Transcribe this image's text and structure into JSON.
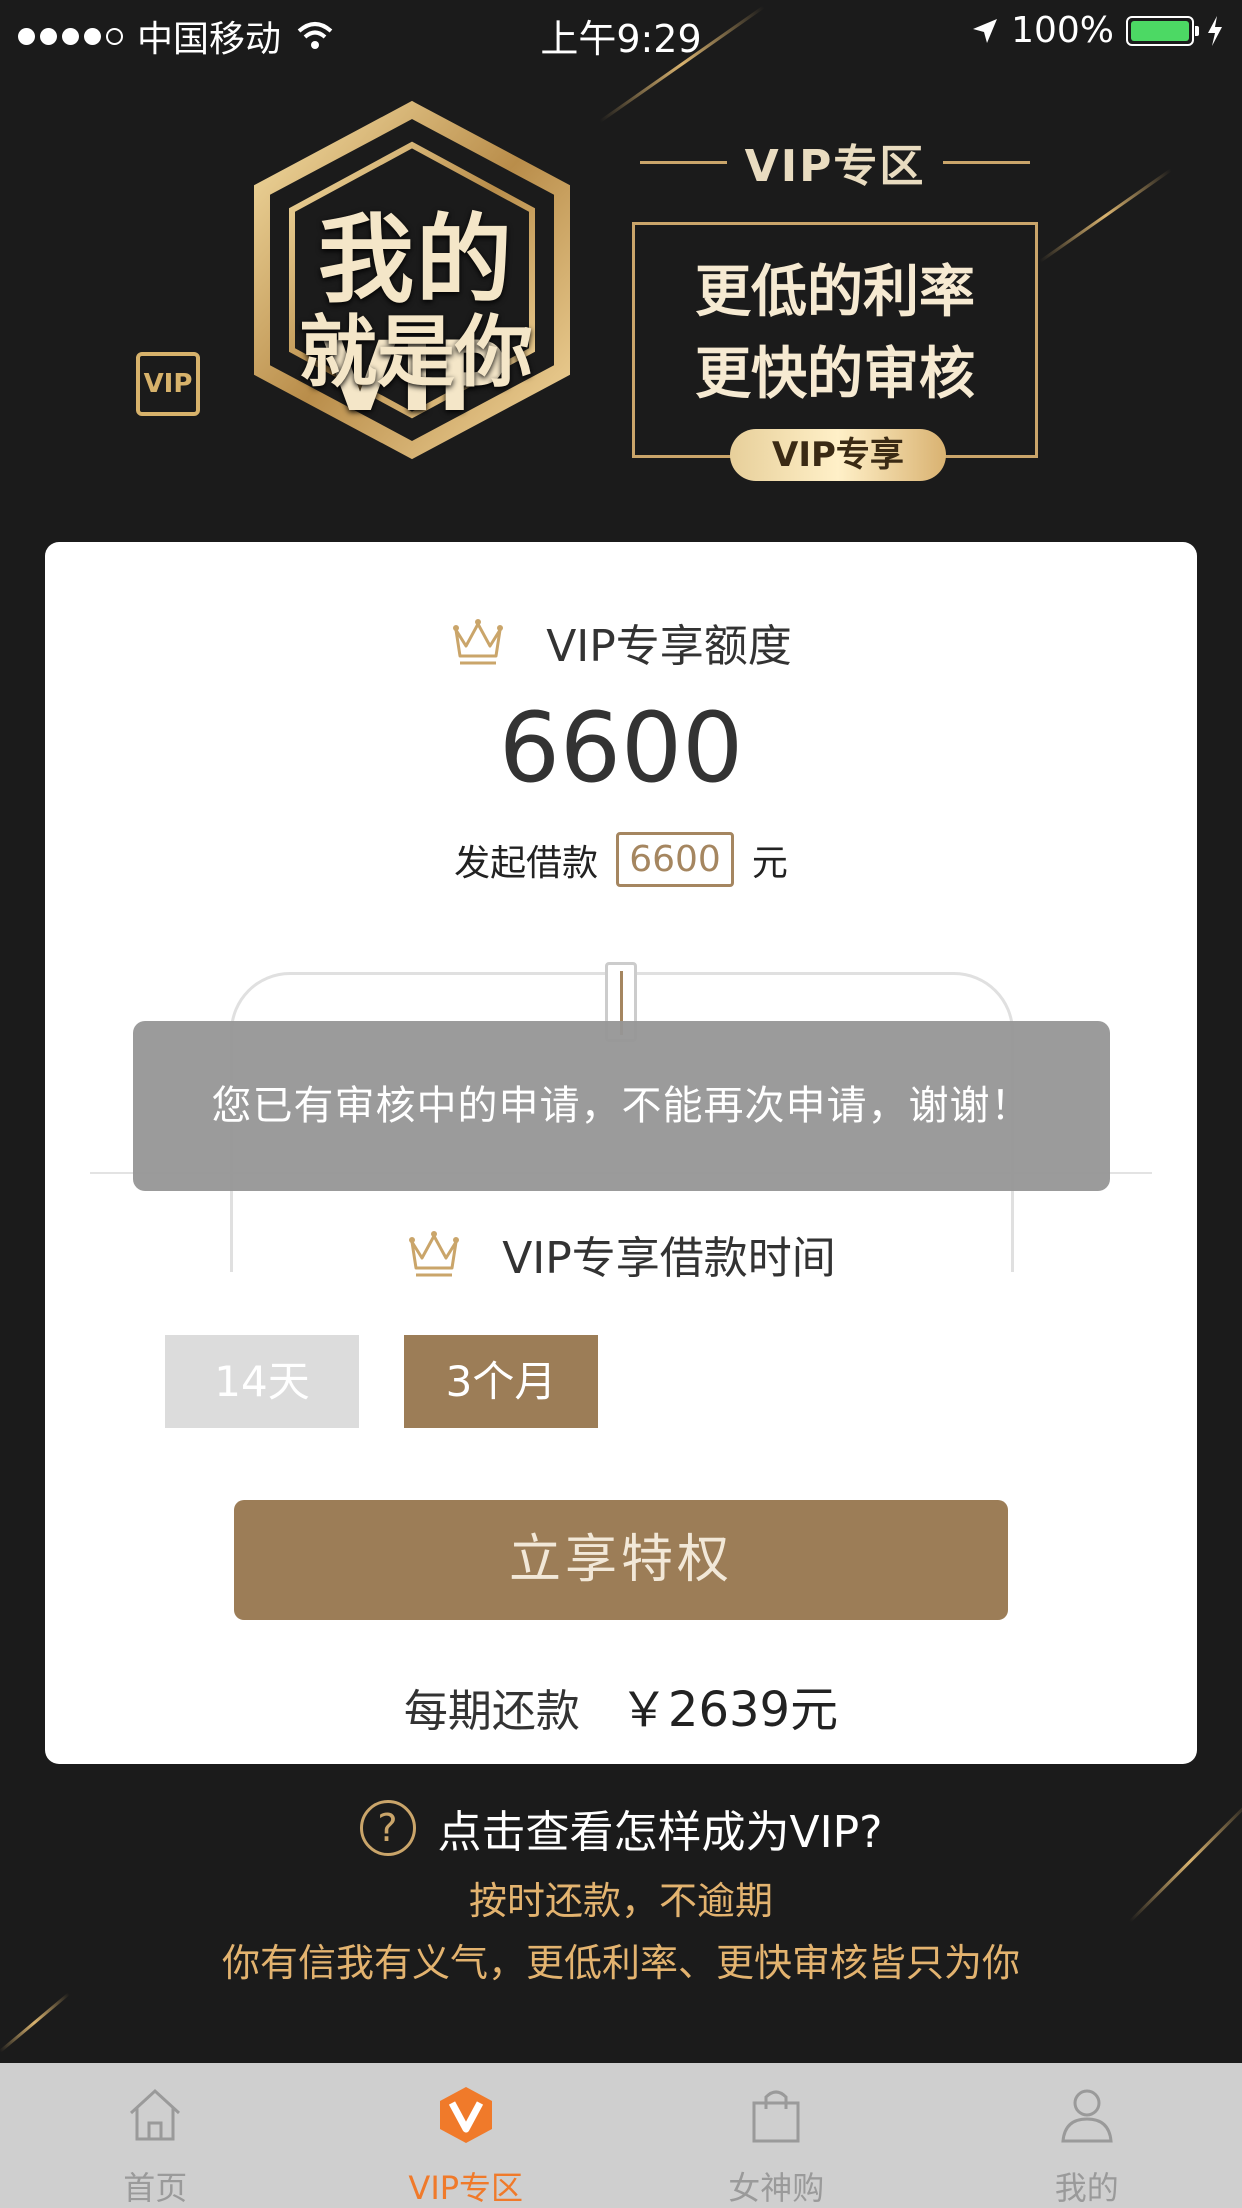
{
  "status_bar": {
    "carrier": "中国移动",
    "time": "上午9:29",
    "battery": "100%"
  },
  "banner": {
    "emblem_line1": "我的VIP",
    "emblem_line2": "就是你",
    "logo_text": "VIP",
    "zone_title": "VIP专区",
    "benefit_line1": "更低的利率",
    "benefit_line2": "更快的审核",
    "pill_label": "VIP专享"
  },
  "card": {
    "limit_title": "VIP专享额度",
    "limit_amount": "6600",
    "borrow_prefix": "发起借款",
    "borrow_value": "6600",
    "borrow_unit": "元",
    "term_title": "VIP专享借款时间",
    "term_options": [
      "14天",
      "3个月"
    ],
    "selected_term": "3个月",
    "cta_label": "立享特权",
    "repay_label": "每期还款",
    "repay_value": "￥2639元"
  },
  "toast": {
    "message": "您已有审核中的申请，不能再次申请，谢谢！"
  },
  "help": {
    "link_text": "点击查看怎样成为VIP?",
    "promo_line1": "按时还款，不逾期",
    "promo_line2": "你有信我有义气，更低利率、更快审核皆只为你"
  },
  "tabbar": {
    "items": [
      {
        "label": "首页",
        "icon": "home-icon",
        "active": false
      },
      {
        "label": "VIP专区",
        "icon": "vip-icon",
        "active": true
      },
      {
        "label": "女神购",
        "icon": "shopping-bag-icon",
        "active": false
      },
      {
        "label": "我的",
        "icon": "person-icon",
        "active": false
      }
    ]
  },
  "colors": {
    "background": "#1b1b1b",
    "accent_gold": "#9c7d57",
    "promo_text": "#e3b36f",
    "tab_active": "#f07a2a"
  }
}
